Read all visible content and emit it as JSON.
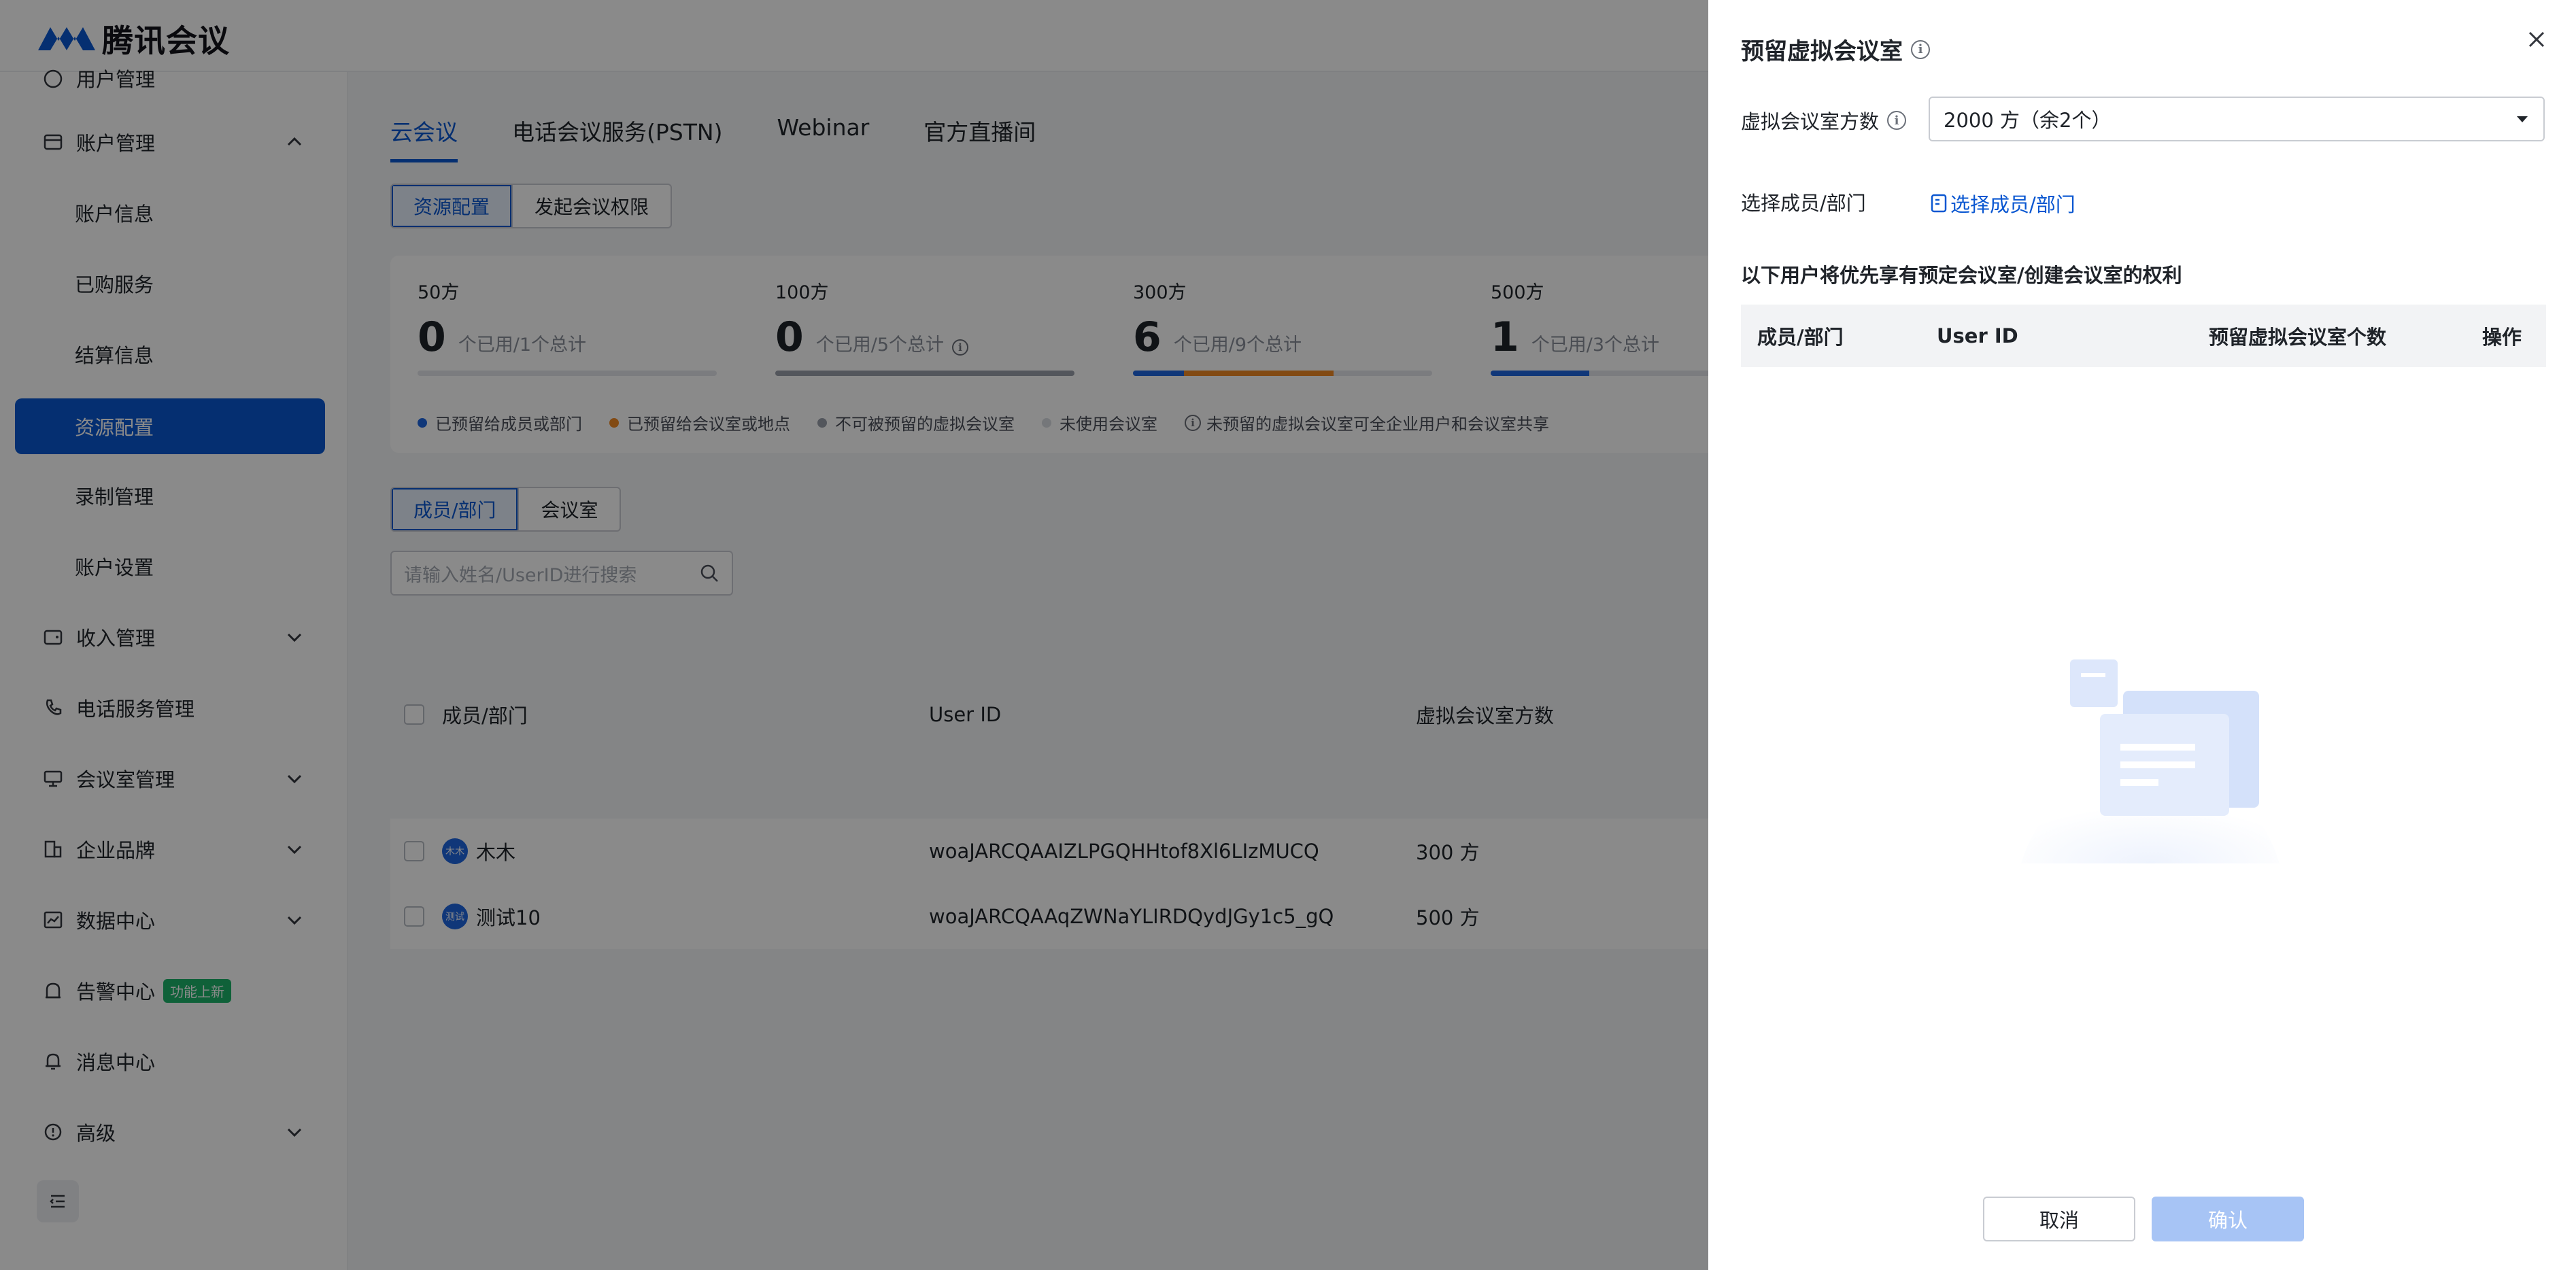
{
  "app": {
    "name": "腾讯会议",
    "brand_color": "#0a57d1"
  },
  "sidebar": {
    "items": [
      {
        "label": "用户管理",
        "icon": "user-icon",
        "expandable": true
      },
      {
        "label": "账户管理",
        "icon": "account-icon",
        "expandable": true,
        "expanded": true
      },
      {
        "label": "账户信息"
      },
      {
        "label": "已购服务"
      },
      {
        "label": "结算信息"
      },
      {
        "label": "资源配置",
        "active": true
      },
      {
        "label": "录制管理"
      },
      {
        "label": "账户设置"
      },
      {
        "label": "收入管理",
        "icon": "wallet-icon",
        "expandable": true
      },
      {
        "label": "电话服务管理",
        "icon": "phone-icon"
      },
      {
        "label": "会议室管理",
        "icon": "meeting-room-icon",
        "expandable": true
      },
      {
        "label": "企业品牌",
        "icon": "brand-icon",
        "expandable": true
      },
      {
        "label": "数据中心",
        "icon": "chart-icon",
        "expandable": true
      },
      {
        "label": "告警中心",
        "icon": "alarm-icon",
        "badge": "功能上新"
      },
      {
        "label": "消息中心",
        "icon": "bell-icon"
      },
      {
        "label": "高级",
        "icon": "advanced-icon",
        "expandable": true
      }
    ]
  },
  "main": {
    "tabs": [
      "云会议",
      "电话会议服务(PSTN)",
      "Webinar",
      "官方直播间"
    ],
    "segment": [
      "资源配置",
      "发起会议权限"
    ],
    "stats": [
      {
        "title": "50方",
        "used": "0",
        "desc": "个已用/1个总计",
        "reserved_member_pct": 0,
        "reserved_room_pct": 0
      },
      {
        "title": "100方",
        "used": "0",
        "desc": "个已用/5个总计",
        "reserved_member_pct": 0,
        "reserved_room_pct": 0,
        "has_info": true
      },
      {
        "title": "300方",
        "used": "6",
        "desc": "个已用/9个总计",
        "reserved_member_pct": 17,
        "reserved_room_pct": 50
      },
      {
        "title": "500方",
        "used": "1",
        "desc": "个已用/3个总计",
        "reserved_member_pct": 33,
        "reserved_room_pct": 0
      }
    ],
    "legend": [
      {
        "label": "已预留给成员或部门",
        "color": "#1f66e0"
      },
      {
        "label": "已预留给会议室或地点",
        "color": "#f08a24"
      },
      {
        "label": "不可被预留的虚拟会议室",
        "color": "#9aa0aa"
      },
      {
        "label": "未使用会议室",
        "color": "#d9dce1"
      }
    ],
    "legend_note": "未预留的虚拟会议室可全企业用户和会议室共享",
    "sub_segment": [
      "成员/部门",
      "会议室"
    ],
    "search_placeholder": "请输入姓名/UserID进行搜索",
    "list_headers": [
      "成员/部门",
      "User ID",
      "虚拟会议室方数"
    ],
    "rows": [
      {
        "avatar": "木木",
        "name": "木木",
        "user_id": "woaJARCQAAIZLPGQHHtof8Xl6LIzMUCQ",
        "size": "300 方"
      },
      {
        "avatar": "测试",
        "name": "测试10",
        "user_id": "woaJARCQAAqZWNaYLIRDQydJGy1c5_gQ",
        "size": "500 方"
      }
    ]
  },
  "drawer": {
    "title": "预留虚拟会议室",
    "size_label": "虚拟会议室方数",
    "size_value": "2000 方（余2个）",
    "member_label": "选择成员/部门",
    "member_link": "选择成员/部门",
    "section_text": "以下用户将优先享有预定会议室/创建会议室的权利",
    "table_headers": [
      "成员/部门",
      "User ID",
      "预留虚拟会议室个数",
      "操作"
    ],
    "cancel_label": "取消",
    "confirm_label": "确认"
  }
}
